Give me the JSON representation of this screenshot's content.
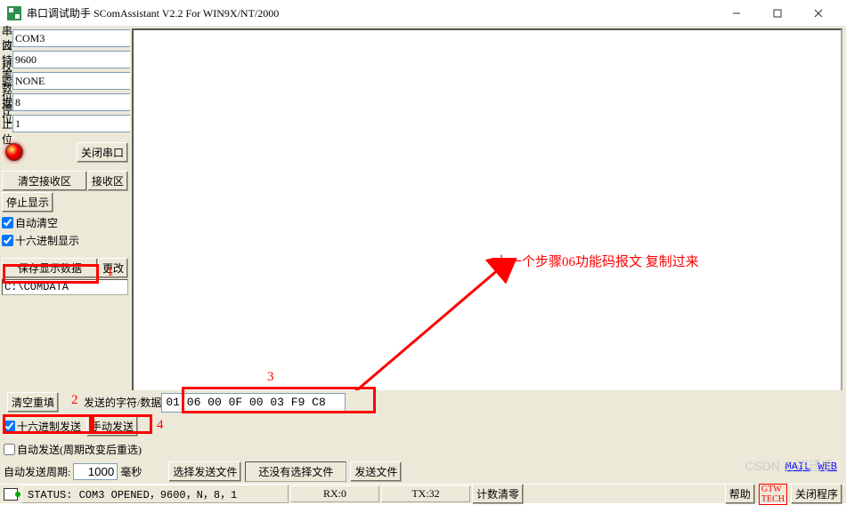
{
  "window": {
    "title": "串口调试助手 SComAssistant V2.2 For WIN9X/NT/2000"
  },
  "port": {
    "label": "串口",
    "value": "COM3"
  },
  "baud": {
    "label": "波特率",
    "value": "9600"
  },
  "parity": {
    "label": "校验位",
    "value": "NONE"
  },
  "databits": {
    "label": "数据位",
    "value": "8"
  },
  "stopbits": {
    "label": "停止位",
    "value": "1"
  },
  "buttons": {
    "close_port": "关闭串口",
    "clear_rx": "清空接收区",
    "rx_area": "接收区",
    "stop_display": "停止显示",
    "save_data": "保存显示数据",
    "change": "更改",
    "clear_refill": "清空重填",
    "manual_send": "手动发送",
    "select_send_file": "选择发送文件",
    "no_file_selected": "还没有选择文件",
    "send_file": "发送文件",
    "help": "帮助",
    "close_program": "关闭程序",
    "count_clear": "计数清零"
  },
  "checks": {
    "auto_clear": "自动清空",
    "hex_display": "十六进制显示",
    "hex_send": "十六进制发送",
    "auto_send": "自动发送(周期改变后重选)"
  },
  "path": "C:\\COMDATA",
  "send": {
    "label": "发送的字符/数据",
    "value": "01 06 00 0F 00 03 F9 C8",
    "period_label": "自动发送周期:",
    "period_value": "1000",
    "period_unit": "毫秒"
  },
  "status": {
    "text": "STATUS: COM3 OPENED，9600，N，8，1",
    "rx": "RX:0",
    "tx": "TX:32"
  },
  "links": {
    "mail": "MAIL",
    "web": "WEB"
  },
  "annotations": {
    "main": "上一个步骤06功能码报文  复制过来",
    "n1": "1",
    "n2": "2",
    "n3": "3",
    "n4": "4"
  },
  "watermark": "CSDN @不迁手"
}
